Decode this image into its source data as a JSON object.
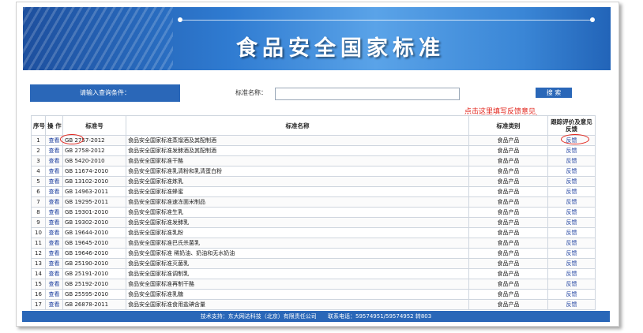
{
  "banner": {
    "title": "食品安全国家标准"
  },
  "search": {
    "prompt": "请输入查询条件：",
    "field_label": "标准名称：",
    "field_value": "",
    "button_label": "搜 索"
  },
  "hint": "点击这里填写反馈意见",
  "table": {
    "headers": {
      "no": "序号",
      "op": "操 作",
      "std_no": "标准号",
      "std_name": "标准名称",
      "category": "标准类别",
      "feedback": "跟踪评价及意见反馈"
    },
    "rows": [
      {
        "no": "1",
        "view": "查看",
        "std_no": "GB 2757-2012",
        "name": "食品安全国家标准蒸馏酒及其配制酒",
        "category": "食品产品",
        "feedback": "反馈"
      },
      {
        "no": "2",
        "view": "查看",
        "std_no": "GB 2758-2012",
        "name": "食品安全国家标准发酵酒及其配制酒",
        "category": "食品产品",
        "feedback": "反馈"
      },
      {
        "no": "3",
        "view": "查看",
        "std_no": "GB 5420-2010",
        "name": "食品安全国家标准干酪",
        "category": "食品产品",
        "feedback": "反馈"
      },
      {
        "no": "4",
        "view": "查看",
        "std_no": "GB 11674-2010",
        "name": "食品安全国家标准乳清粉和乳清蛋白粉",
        "category": "食品产品",
        "feedback": "反馈"
      },
      {
        "no": "5",
        "view": "查看",
        "std_no": "GB 13102-2010",
        "name": "食品安全国家标准炼乳",
        "category": "食品产品",
        "feedback": "反馈"
      },
      {
        "no": "6",
        "view": "查看",
        "std_no": "GB 14963-2011",
        "name": "食品安全国家标准蜂蜜",
        "category": "食品产品",
        "feedback": "反馈"
      },
      {
        "no": "7",
        "view": "查看",
        "std_no": "GB 19295-2011",
        "name": "食品安全国家标准速冻面米制品",
        "category": "食品产品",
        "feedback": "反馈"
      },
      {
        "no": "8",
        "view": "查看",
        "std_no": "GB 19301-2010",
        "name": "食品安全国家标准生乳",
        "category": "食品产品",
        "feedback": "反馈"
      },
      {
        "no": "9",
        "view": "查看",
        "std_no": "GB 19302-2010",
        "name": "食品安全国家标准发酵乳",
        "category": "食品产品",
        "feedback": "反馈"
      },
      {
        "no": "10",
        "view": "查看",
        "std_no": "GB 19644-2010",
        "name": "食品安全国家标准乳粉",
        "category": "食品产品",
        "feedback": "反馈"
      },
      {
        "no": "11",
        "view": "查看",
        "std_no": "GB 19645-2010",
        "name": "食品安全国家标准巴氏杀菌乳",
        "category": "食品产品",
        "feedback": "反馈"
      },
      {
        "no": "12",
        "view": "查看",
        "std_no": "GB 19646-2010",
        "name": "食品安全国家标准 稀奶油、奶油和无水奶油",
        "category": "食品产品",
        "feedback": "反馈"
      },
      {
        "no": "13",
        "view": "查看",
        "std_no": "GB 25190-2010",
        "name": "食品安全国家标准灭菌乳",
        "category": "食品产品",
        "feedback": "反馈"
      },
      {
        "no": "14",
        "view": "查看",
        "std_no": "GB 25191-2010",
        "name": "食品安全国家标准调制乳",
        "category": "食品产品",
        "feedback": "反馈"
      },
      {
        "no": "15",
        "view": "查看",
        "std_no": "GB 25192-2010",
        "name": "食品安全国家标准再制干酪",
        "category": "食品产品",
        "feedback": "反馈"
      },
      {
        "no": "16",
        "view": "查看",
        "std_no": "GB 25595-2010",
        "name": "食品安全国家标准乳糖",
        "category": "食品产品",
        "feedback": "反馈"
      },
      {
        "no": "17",
        "view": "查看",
        "std_no": "GB 26878-2011",
        "name": "食品安全国家标准食用盐碘含量",
        "category": "食品产品",
        "feedback": "反馈"
      }
    ]
  },
  "footer": {
    "support": "技术支持：东大网达科技（北京）有限责任公司",
    "phone": "联系电话：59574951/59574952 转803"
  },
  "colors": {
    "accent": "#2a67b8",
    "annotation": "#e2231a",
    "link": "#1a3d9e"
  }
}
